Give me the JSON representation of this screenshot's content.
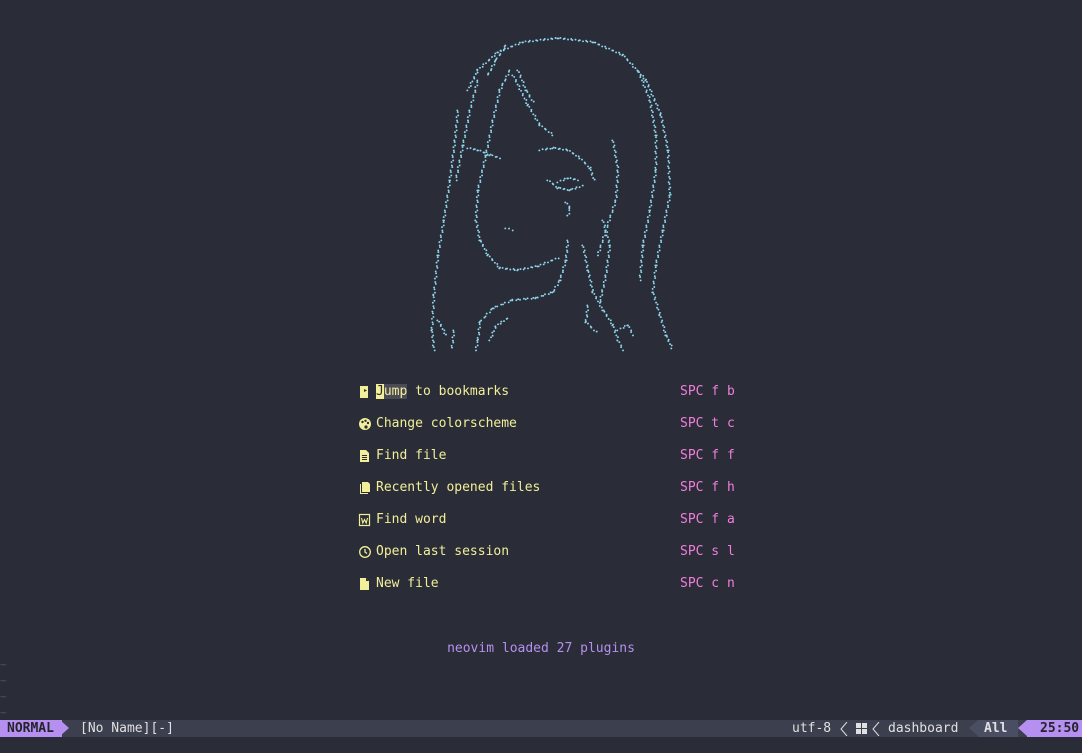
{
  "dashboard": {
    "items": [
      {
        "icon": "bookmark-icon",
        "label_head": "J",
        "label_hl": "ump",
        "label_rest": " to bookmarks",
        "key": "SPC f b"
      },
      {
        "icon": "palette-icon",
        "label": "Change colorscheme",
        "key": "SPC t c"
      },
      {
        "icon": "file-icon",
        "label": "Find file",
        "key": "SPC f f"
      },
      {
        "icon": "files-icon",
        "label": "Recently opened files",
        "key": "SPC f h"
      },
      {
        "icon": "word-icon",
        "label": "Find word",
        "key": "SPC f a"
      },
      {
        "icon": "history-icon",
        "label": "Open last session",
        "key": "SPC s l"
      },
      {
        "icon": "new-file-icon",
        "label": "New file",
        "key": "SPC c n"
      }
    ],
    "footer": "neovim loaded 27 plugins"
  },
  "empty_lines": [
    "~",
    "~",
    "~",
    "~"
  ],
  "statusline": {
    "mode": "NORMAL",
    "buffer": "[No Name][-]",
    "encoding": "utf-8",
    "os_icon": "windows-icon",
    "filetype": "dashboard",
    "position": "All",
    "time": "25:50"
  },
  "colors": {
    "background": "#2a2c37",
    "art": "#8fd6ee",
    "menu_text": "#f1ef99",
    "shortcut": "#f07edc",
    "footer": "#b590f0",
    "mode_bg": "#b590f0",
    "statusline_bg": "#3c3f4d"
  }
}
